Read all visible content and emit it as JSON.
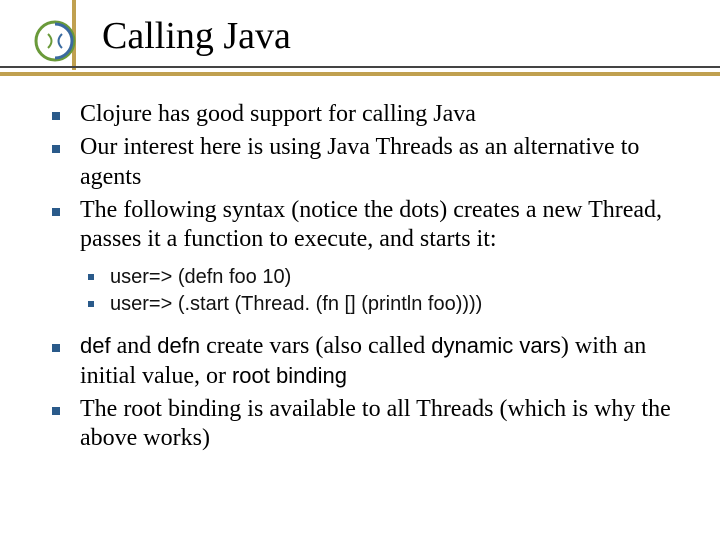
{
  "title": "Calling Java",
  "bullets": {
    "b1": "Clojure has good support for calling Java",
    "b2": "Our interest here is using Java Threads as an alternative to agents",
    "b3": "The following syntax (notice the dots) creates a new Thread, passes it a function to execute, and starts it:",
    "sub1": "user=> (defn foo 10)",
    "sub2": "user=> (.start (Thread. (fn [] (println foo))))",
    "b4_pre": "def",
    "b4_mid1": " and ",
    "b4_kw2": "defn",
    "b4_mid2": " create vars (also called ",
    "b4_dyn": "dynamic vars",
    "b4_mid3": ") with an initial value, or ",
    "b4_root": "root binding",
    "b5": "The root binding is available to all Threads (which is why the above works)"
  }
}
